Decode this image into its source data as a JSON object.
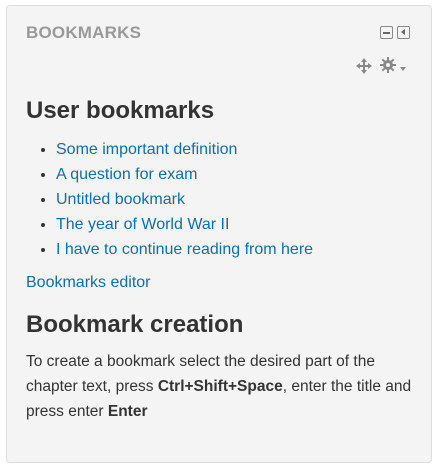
{
  "block": {
    "title": "BOOKMARKS",
    "controls": [
      "minus-square-icon",
      "dock-icon",
      "move-icon",
      "gear-icon",
      "caret-down-icon"
    ]
  },
  "user_section": {
    "heading": "User bookmarks",
    "bookmarks": [
      "Some important definition",
      "A question for exam",
      "Untitled bookmark",
      "The year of World War II",
      "I have to continue reading from here"
    ],
    "editor_link": "Bookmarks editor"
  },
  "creation_section": {
    "heading": "Bookmark creation",
    "text_1": "To create a bookmark select the desired part of the chapter text, press ",
    "shortcut": "Ctrl+Shift+Space",
    "text_2": ", enter the title and press enter ",
    "enter_key": "Enter"
  },
  "colors": {
    "link": "#0f6ea8",
    "block_bg": "#f4f4f4",
    "title": "#999999"
  }
}
